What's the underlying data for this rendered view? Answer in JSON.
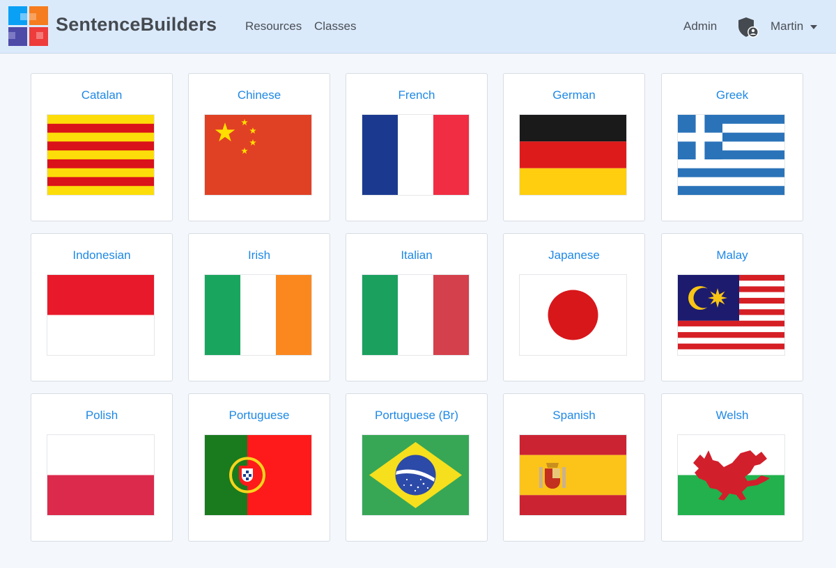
{
  "brand": {
    "name": "SentenceBuilders",
    "logo_icon": "four-squares-logo",
    "colors": [
      "#0aa0f5",
      "#f57c1f",
      "#4e4aa8",
      "#ee3b3b"
    ]
  },
  "nav": {
    "links": [
      "Resources",
      "Classes"
    ],
    "admin": "Admin",
    "user": "Martin",
    "user_icon": "shield-user-icon",
    "dropdown_icon": "caret-down-icon"
  },
  "languages": [
    {
      "name": "Catalan",
      "flag": "catalonia-flag"
    },
    {
      "name": "Chinese",
      "flag": "china-flag"
    },
    {
      "name": "French",
      "flag": "france-flag"
    },
    {
      "name": "German",
      "flag": "germany-flag"
    },
    {
      "name": "Greek",
      "flag": "greece-flag"
    },
    {
      "name": "Indonesian",
      "flag": "indonesia-flag"
    },
    {
      "name": "Irish",
      "flag": "ireland-flag"
    },
    {
      "name": "Italian",
      "flag": "italy-flag"
    },
    {
      "name": "Japanese",
      "flag": "japan-flag"
    },
    {
      "name": "Malay",
      "flag": "malaysia-flag"
    },
    {
      "name": "Polish",
      "flag": "poland-flag"
    },
    {
      "name": "Portuguese",
      "flag": "portugal-flag"
    },
    {
      "name": "Portuguese (Br)",
      "flag": "brazil-flag"
    },
    {
      "name": "Spanish",
      "flag": "spain-flag"
    },
    {
      "name": "Welsh",
      "flag": "wales-flag"
    }
  ],
  "colors": {
    "navbar_bg": "#dbeafb",
    "page_bg": "#f4f7fb",
    "link": "#1e88e5"
  }
}
